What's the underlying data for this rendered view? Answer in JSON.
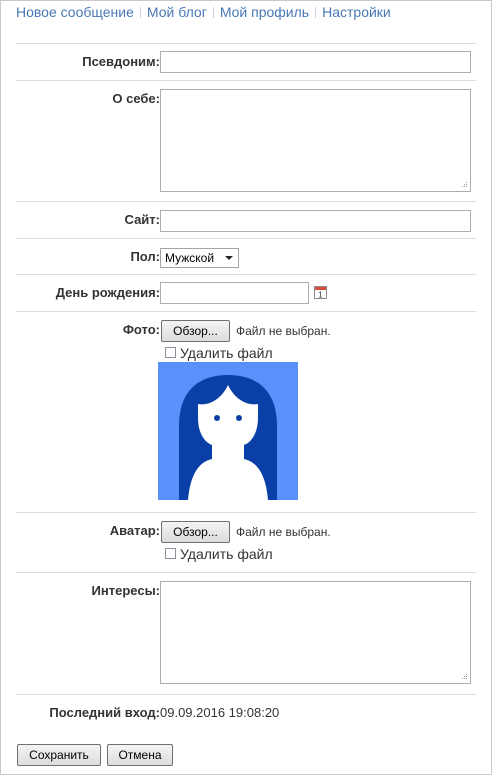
{
  "nav": {
    "items": [
      "Новое сообщение",
      "Мой блог",
      "Мой профиль",
      "Настройки"
    ]
  },
  "form": {
    "nickname": {
      "label": "Псевдоним:",
      "value": ""
    },
    "about": {
      "label": "О себе:",
      "value": ""
    },
    "site": {
      "label": "Сайт:",
      "value": ""
    },
    "gender": {
      "label": "Пол:",
      "selected": "Мужской"
    },
    "birthday": {
      "label": "День рождения:",
      "value": "",
      "calendar_glyph": "1"
    },
    "photo": {
      "label": "Фото:",
      "browse_label": "Обзор...",
      "file_status": "Файл не выбран.",
      "delete_label": "Удалить файл",
      "delete_checked": false
    },
    "avatar": {
      "label": "Аватар:",
      "browse_label": "Обзор...",
      "file_status": "Файл не выбран.",
      "delete_label": "Удалить файл",
      "delete_checked": false
    },
    "interests": {
      "label": "Интересы:",
      "value": ""
    },
    "last_login": {
      "label": "Последний вход:",
      "value": "09.09.2016 19:08:20"
    }
  },
  "actions": {
    "save_label": "Сохранить",
    "cancel_label": "Отмена"
  },
  "colors": {
    "link": "#4a78b5",
    "photo_bg": "#5b8ff9",
    "photo_figure": "#0a3fa8"
  }
}
